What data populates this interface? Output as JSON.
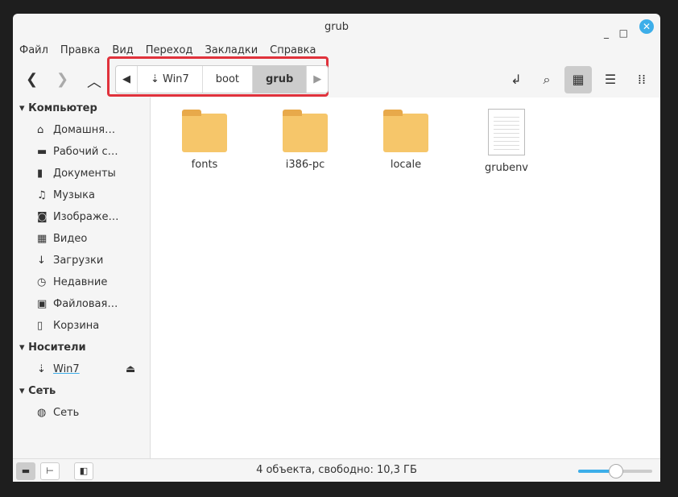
{
  "window": {
    "title": "grub"
  },
  "menu": [
    "Файл",
    "Правка",
    "Вид",
    "Переход",
    "Закладки",
    "Справка"
  ],
  "breadcrumbs": [
    "Win7",
    "boot",
    "grub"
  ],
  "sidebar": {
    "computer": {
      "label": "Компьютер",
      "items": [
        {
          "icon": "home-icon",
          "glyph": "⌂",
          "label": "Домашня…"
        },
        {
          "icon": "desktop-icon",
          "glyph": "▬",
          "label": "Рабочий с…"
        },
        {
          "icon": "documents-icon",
          "glyph": "▮",
          "label": "Документы"
        },
        {
          "icon": "music-icon",
          "glyph": "♫",
          "label": "Музыка"
        },
        {
          "icon": "camera-icon",
          "glyph": "◙",
          "label": "Изображе…"
        },
        {
          "icon": "video-icon",
          "glyph": "▦",
          "label": "Видео"
        },
        {
          "icon": "download-icon",
          "glyph": "↓",
          "label": "Загрузки"
        },
        {
          "icon": "recent-icon",
          "glyph": "◷",
          "label": "Недавние"
        },
        {
          "icon": "filesystem-icon",
          "glyph": "▣",
          "label": "Файловая…"
        },
        {
          "icon": "trash-icon",
          "glyph": "▯",
          "label": "Корзина"
        }
      ]
    },
    "devices": {
      "label": "Носители",
      "items": [
        {
          "icon": "usb-icon",
          "glyph": "⇣",
          "label": "Win7"
        }
      ]
    },
    "network": {
      "label": "Сеть",
      "items": [
        {
          "icon": "network-icon",
          "glyph": "◍",
          "label": "Сеть"
        }
      ]
    }
  },
  "files": [
    {
      "name": "fonts",
      "type": "folder"
    },
    {
      "name": "i386-pc",
      "type": "folder"
    },
    {
      "name": "locale",
      "type": "folder"
    },
    {
      "name": "grubenv",
      "type": "file"
    }
  ],
  "status": {
    "text": "4 объекта, свободно: 10,3 ГБ",
    "zoom_fraction": 0.5
  }
}
